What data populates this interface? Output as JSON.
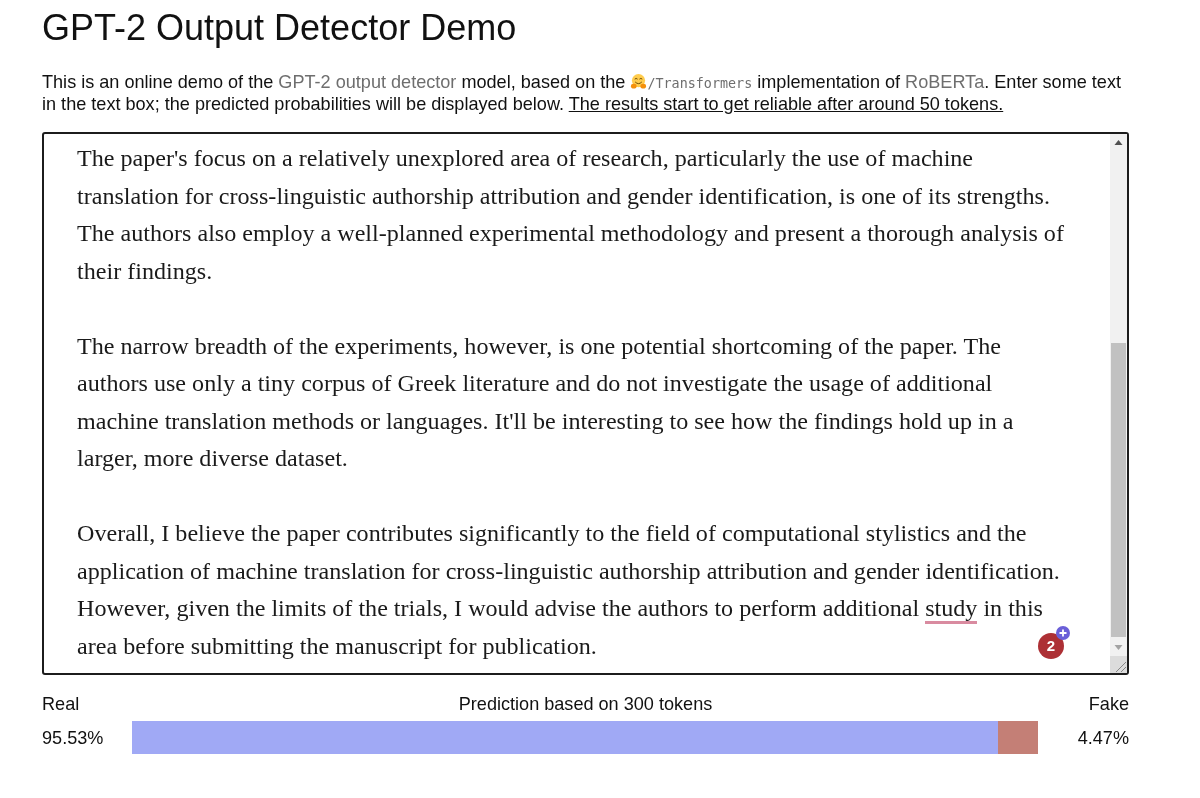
{
  "title": "GPT-2 Output Detector Demo",
  "intro": [
    {
      "kind": "text",
      "text": "This is an online demo of the "
    },
    {
      "kind": "link",
      "text": "GPT-2 output detector"
    },
    {
      "kind": "text",
      "text": " model, based on the "
    },
    {
      "kind": "code_link",
      "text": "/Transformers"
    },
    {
      "kind": "text",
      "text": " implementation of "
    },
    {
      "kind": "link",
      "text": "RoBERTa"
    },
    {
      "kind": "text",
      "text": ". Enter some text in the text box; the predicted probabilities will be displayed below. "
    },
    {
      "kind": "underlined",
      "text": "The results start to get reliable after around 50 tokens."
    }
  ],
  "text_box": {
    "paragraphs": [
      {
        "segments": [
          {
            "text": "The paper's focus on a relatively unexplored area of research, particularly the use of machine translation for cross-linguistic authorship attribution and gender identification, is one of its strengths. The authors also employ a well-planned experimental methodology and present a thorough analysis of their findings.",
            "flagged": false
          }
        ]
      },
      {
        "segments": [
          {
            "text": "The narrow breadth of the experiments, however, is one potential shortcoming of the paper. The authors use only a tiny corpus of Greek literature and do not investigate the usage of additional machine translation methods or languages. It'll be interesting to see how the findings hold up in a larger, more diverse dataset.",
            "flagged": false
          }
        ]
      },
      {
        "segments": [
          {
            "text": "Overall, I believe the paper contributes significantly to the field of computational stylistics and the application of machine translation for cross-linguistic authorship attribution and gender identification. However, given the limits of the trials, I would advise the authors to perform additional ",
            "flagged": false
          },
          {
            "text": "study",
            "flagged": true
          },
          {
            "text": " in this area before submitting the manuscript for publication.",
            "flagged": false
          }
        ]
      }
    ]
  },
  "grammar_badge": {
    "count": "2"
  },
  "prediction": {
    "real_label": "Real",
    "caption": "Prediction based on 300 tokens",
    "fake_label": "Fake",
    "real_value": "95.53%",
    "fake_value": "4.47%",
    "level": 0.9553
  }
}
